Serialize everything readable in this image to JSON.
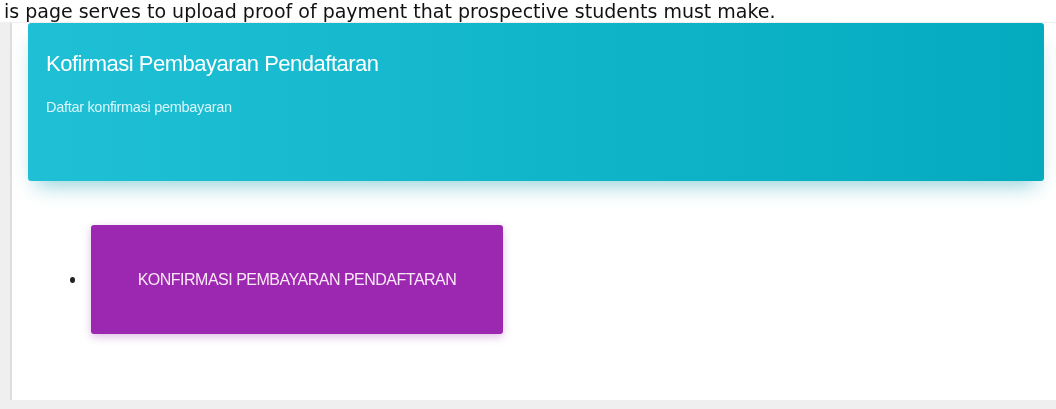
{
  "caption": "is page serves to upload proof of payment that prospective students must make.",
  "header": {
    "title": "Kofirmasi Pembayaran Pendaftaran",
    "subtitle": "Daftar konfirmasi pembayaran"
  },
  "links": [
    {
      "label": "KONFIRMASI PEMBAYARAN PENDAFTARAN"
    }
  ]
}
